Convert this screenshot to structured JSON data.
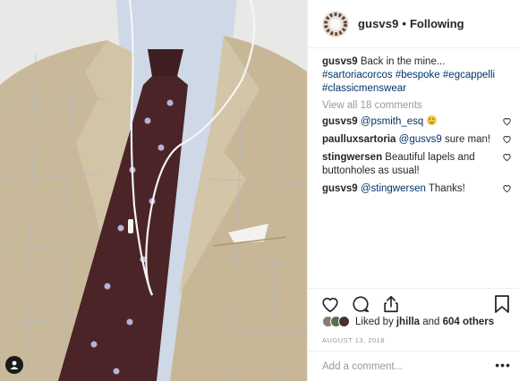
{
  "post": {
    "author": "gusvs9",
    "follow_separator": "•",
    "follow_state": "Following",
    "caption_author": "gusvs9",
    "caption_text": " Back in the mine...",
    "hashtags": [
      "#sartoriacorcos",
      "#bespoke",
      "#egcappelli",
      "#classicmenswear"
    ],
    "view_all": "View all 18 comments",
    "comments": [
      {
        "user": "gusvs9",
        "mention": "@psmith_esq",
        "text": "",
        "emoji": "grinning-face"
      },
      {
        "user": "paulluxsartoria",
        "mention": "@gusvs9",
        "text": " sure man!"
      },
      {
        "user": "stingwersen",
        "mention": "",
        "text": " Beautiful lapels and buttonholes as usual!"
      },
      {
        "user": "gusvs9",
        "mention": "@stingwersen",
        "text": " Thanks!"
      }
    ],
    "likes_prefix": "Liked by ",
    "likes_user": "jhilla",
    "likes_and": " and ",
    "likes_count": "604 others",
    "timestamp": "August 13, 2018",
    "add_comment_placeholder": "Add a comment...",
    "more_label": "•••"
  },
  "icons": {
    "like": "heart-icon",
    "comment": "comment-icon",
    "share": "share-icon",
    "save": "bookmark-icon",
    "tag": "user-tag-icon"
  },
  "colors": {
    "hashtag": "#003569",
    "muted": "#999999",
    "text": "#262626"
  }
}
